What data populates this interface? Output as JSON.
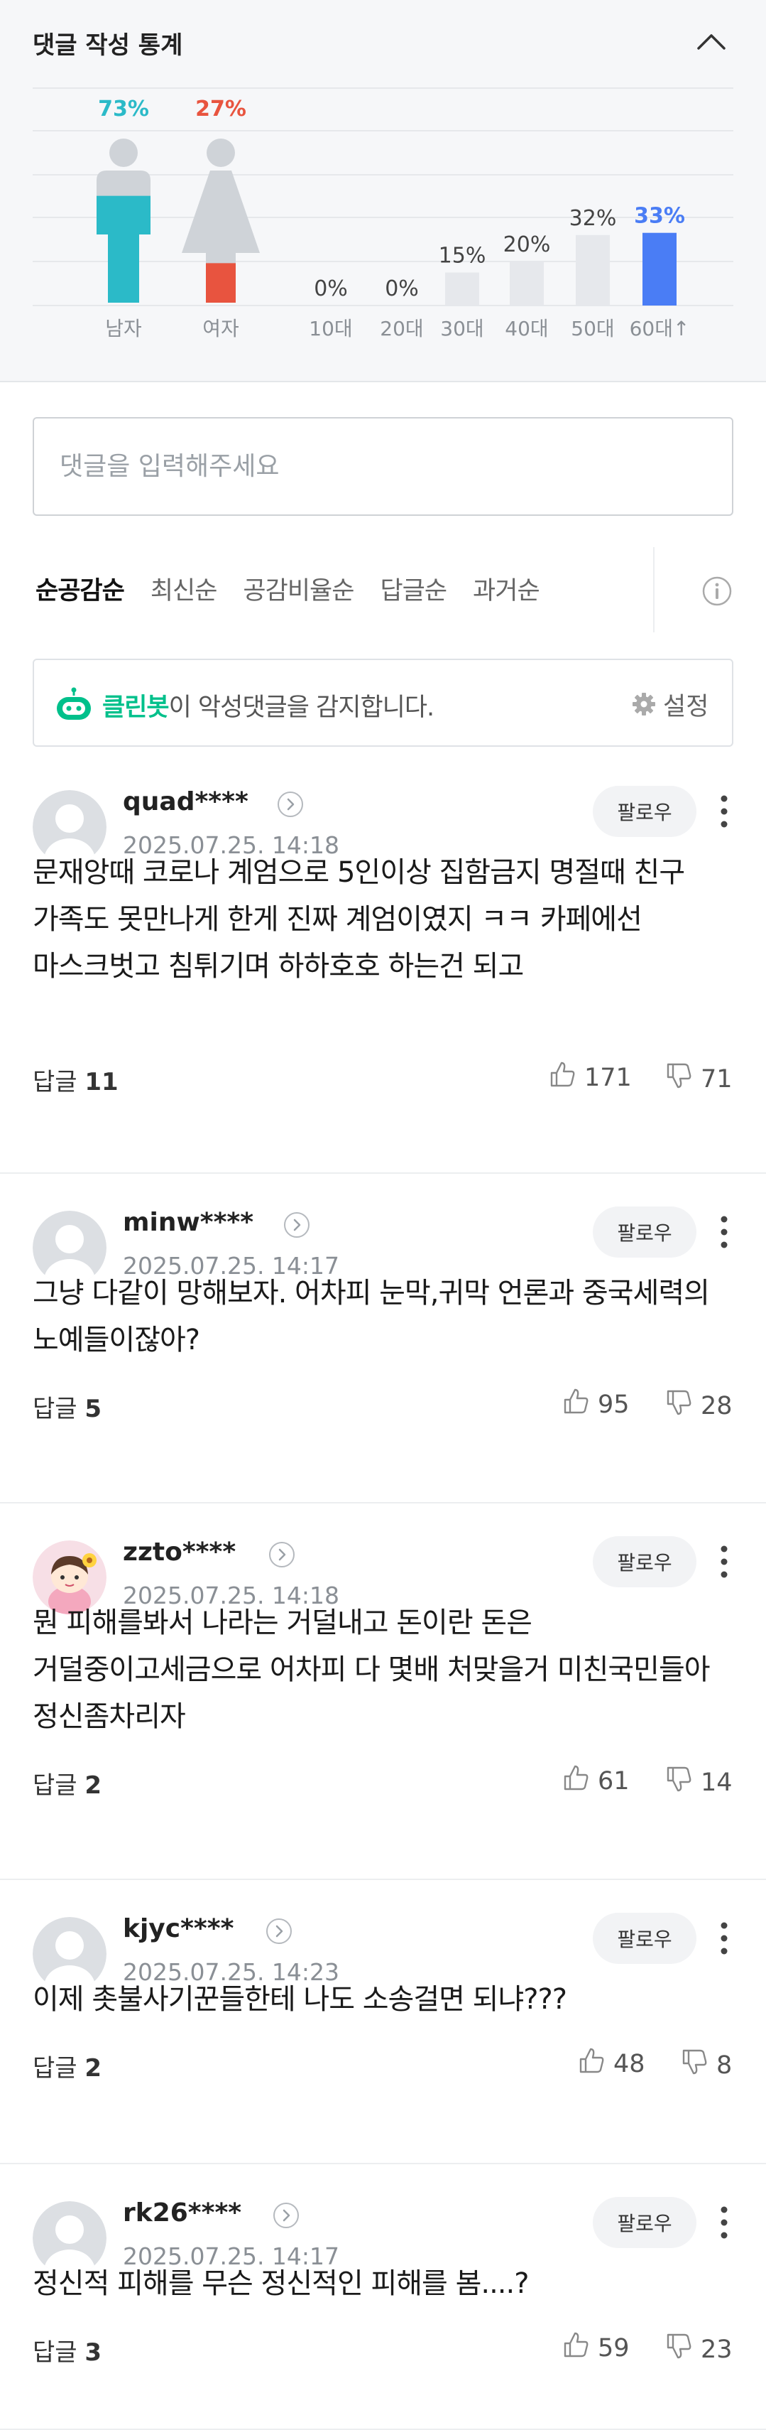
{
  "stats": {
    "title": "댓글 작성 통계",
    "gender": [
      {
        "label": "남자",
        "percent_text": "73%",
        "value": 73,
        "color": "#2bbac8"
      },
      {
        "label": "여자",
        "percent_text": "27%",
        "value": 27,
        "color": "#e8543f"
      }
    ],
    "age": [
      {
        "label": "10대",
        "percent_text": "0%",
        "value": 0
      },
      {
        "label": "20대",
        "percent_text": "0%",
        "value": 0
      },
      {
        "label": "30대",
        "percent_text": "15%",
        "value": 15
      },
      {
        "label": "40대",
        "percent_text": "20%",
        "value": 20
      },
      {
        "label": "50대",
        "percent_text": "32%",
        "value": 32
      },
      {
        "label": "60대↑",
        "percent_text": "33%",
        "value": 33
      }
    ],
    "colors": {
      "highlight": "#4a7df5",
      "bar": "#e6e8ec",
      "text_dark": "#444",
      "text_muted": "#8a8f95"
    }
  },
  "input": {
    "placeholder": "댓글을 입력해주세요"
  },
  "sort_tabs": [
    {
      "label": "순공감순",
      "active": true
    },
    {
      "label": "최신순",
      "active": false
    },
    {
      "label": "공감비율순",
      "active": false
    },
    {
      "label": "답글순",
      "active": false
    },
    {
      "label": "과거순",
      "active": false
    }
  ],
  "cleanbot": {
    "brand": "클린봇",
    "text": "이 악성댓글을 감지합니다.",
    "settings_label": "설정",
    "brand_color": "#00c08b"
  },
  "comments": [
    {
      "author": "quad****",
      "timestamp": "2025.07.25. 14:18",
      "follow_label": "팔로우",
      "body": "문재앙때 코로나 계엄으로 5인이상 집함금지 명절때 친구 가족도 못만나게 한게 진짜 계엄이였지 ㅋㅋ 카페에선 마스크벗고 침튀기며 하하호호 하는건 되고",
      "reply_label": "답글",
      "reply_count": "11",
      "likes": "171",
      "dislikes": "71",
      "avatar": "default"
    },
    {
      "author": "minw****",
      "timestamp": "2025.07.25. 14:17",
      "follow_label": "팔로우",
      "body": "그냥 다같이 망해보자. 어차피 눈막,귀막 언론과 중국세력의 노예들이잖아?",
      "reply_label": "답글",
      "reply_count": "5",
      "likes": "95",
      "dislikes": "28",
      "avatar": "default"
    },
    {
      "author": "zzto****",
      "timestamp": "2025.07.25. 14:18",
      "follow_label": "팔로우",
      "body": "뭔 피해를봐서 나라는 거덜내고 돈이란 돈은 거덜중이고세금으로 어차피 다 몇배 처맞을거 미친국민들아 정신좀차리자",
      "reply_label": "답글",
      "reply_count": "2",
      "likes": "61",
      "dislikes": "14",
      "avatar": "character"
    },
    {
      "author": "kjyc****",
      "timestamp": "2025.07.25. 14:23",
      "follow_label": "팔로우",
      "body": "이제 촛불사기꾼들한테 나도 소송걸면 되냐???",
      "reply_label": "답글",
      "reply_count": "2",
      "likes": "48",
      "dislikes": "8",
      "avatar": "default"
    },
    {
      "author": "rk26****",
      "timestamp": "2025.07.25. 14:17",
      "follow_label": "팔로우",
      "body": "정신적 피해를 무슨 정신적인 피해를 봄....?",
      "reply_label": "답글",
      "reply_count": "3",
      "likes": "59",
      "dislikes": "23",
      "avatar": "default"
    }
  ]
}
